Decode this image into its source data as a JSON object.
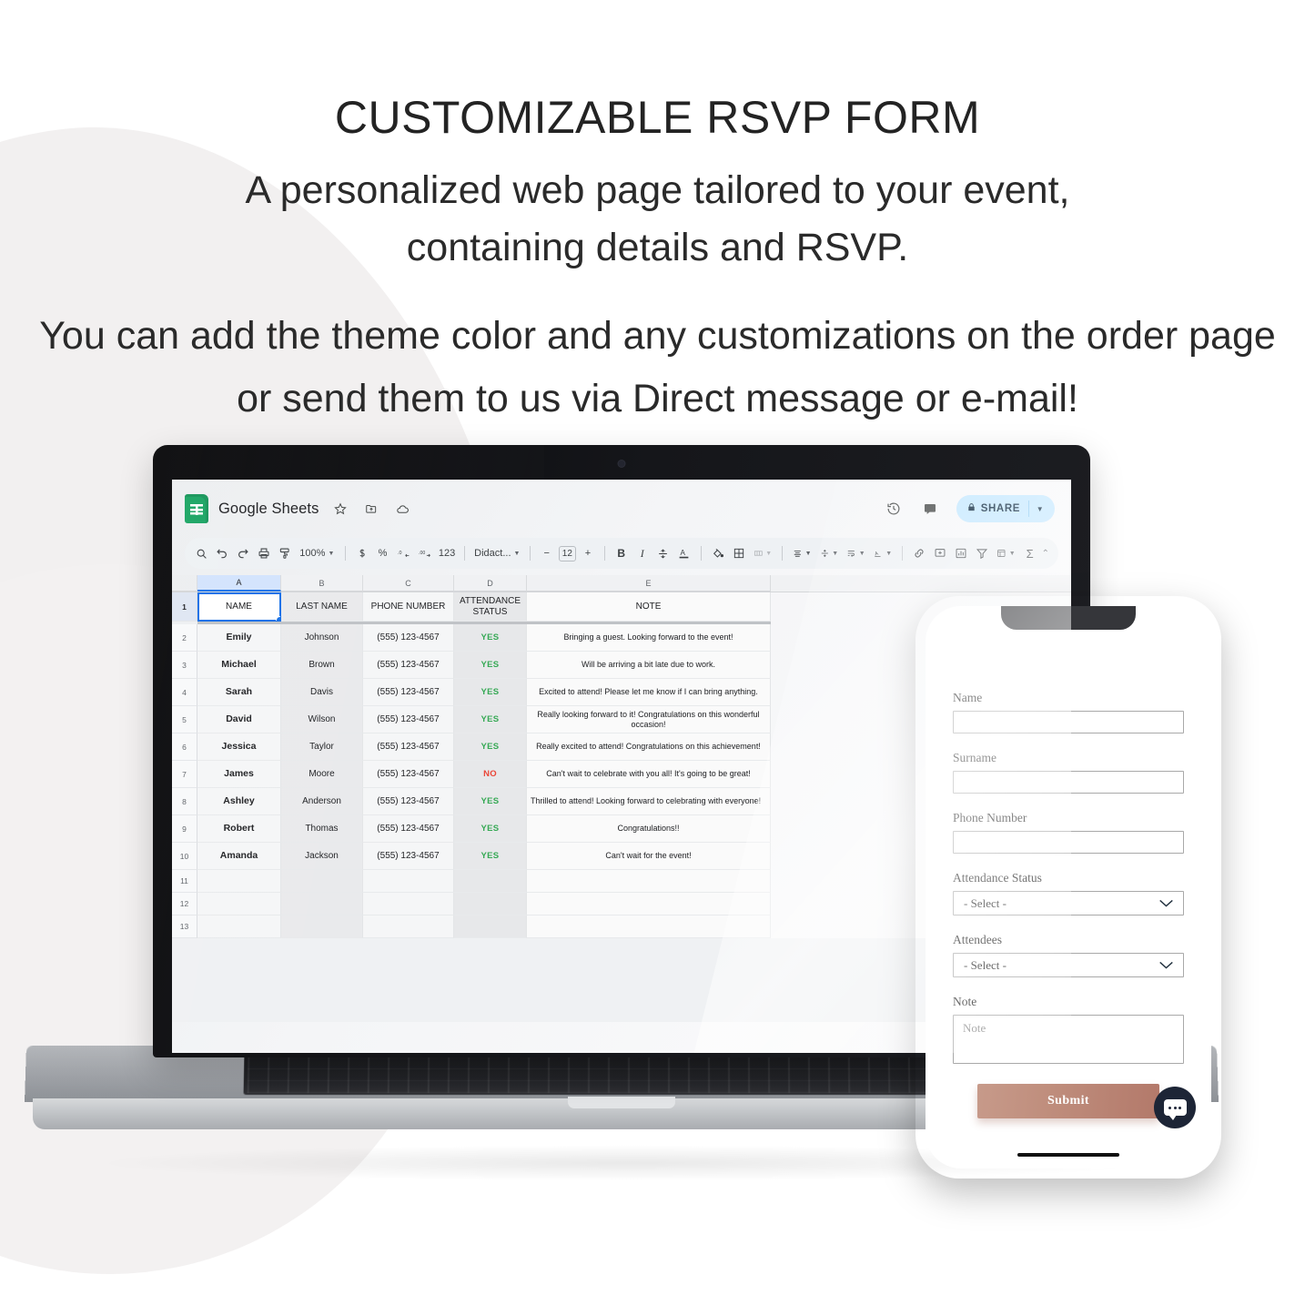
{
  "header": {
    "title": "CUSTOMIZABLE RSVP FORM",
    "subtitle_line1": "A personalized web page tailored to your event,",
    "subtitle_line2": "containing details and RSVP.",
    "body_line1": "You can add the theme color and any customizations on the order page",
    "body_line2": "or send them to us via Direct message or e-mail!"
  },
  "sheets": {
    "app_title": "Google Sheets",
    "head_icons": [
      "star-icon",
      "move-to-folder-icon",
      "cloud-saved-icon"
    ],
    "head_right_icons": [
      "version-history-icon",
      "comment-icon"
    ],
    "share_label": "SHARE",
    "toolbar": {
      "zoom": "100%",
      "font": "Didact...",
      "font_size": "12",
      "number_format": "123",
      "percent": "%",
      "decimal_decrease": ".0",
      "decimal_increase": ".00",
      "bold": "B",
      "italic": "I",
      "minus": "−",
      "plus": "+",
      "sigma": "Σ"
    },
    "column_letters": [
      "A",
      "B",
      "C",
      "D",
      "E"
    ],
    "headers": [
      "NAME",
      "LAST NAME",
      "PHONE NUMBER",
      "ATTENDANCE STATUS",
      "NOTE"
    ],
    "row_numbers": [
      "1",
      "2",
      "3",
      "4",
      "5",
      "6",
      "7",
      "8",
      "9",
      "10",
      "11",
      "12",
      "13"
    ],
    "rows": [
      {
        "n": "2",
        "name": "Emily",
        "last": "Johnson",
        "phone": "(555) 123-4567",
        "status": "YES",
        "note": "Bringing a guest. Looking forward to the event!"
      },
      {
        "n": "3",
        "name": "Michael",
        "last": "Brown",
        "phone": "(555) 123-4567",
        "status": "YES",
        "note": "Will be arriving a bit late due to work."
      },
      {
        "n": "4",
        "name": "Sarah",
        "last": "Davis",
        "phone": "(555) 123-4567",
        "status": "YES",
        "note": "Excited to attend! Please let me know if I can bring anything."
      },
      {
        "n": "5",
        "name": "David",
        "last": "Wilson",
        "phone": "(555) 123-4567",
        "status": "YES",
        "note": "Really looking forward to it! Congratulations on this wonderful occasion!"
      },
      {
        "n": "6",
        "name": "Jessica",
        "last": "Taylor",
        "phone": "(555) 123-4567",
        "status": "YES",
        "note": "Really excited to attend! Congratulations on this achievement!"
      },
      {
        "n": "7",
        "name": "James",
        "last": "Moore",
        "phone": "(555) 123-4567",
        "status": "NO",
        "note": "Can't wait to celebrate with you all! It's going to be great!"
      },
      {
        "n": "8",
        "name": "Ashley",
        "last": "Anderson",
        "phone": "(555) 123-4567",
        "status": "YES",
        "note": "Thrilled to attend! Looking forward to celebrating with everyone!"
      },
      {
        "n": "9",
        "name": "Robert",
        "last": "Thomas",
        "phone": "(555) 123-4567",
        "status": "YES",
        "note": "Congratulations!!"
      },
      {
        "n": "10",
        "name": "Amanda",
        "last": "Jackson",
        "phone": "(555) 123-4567",
        "status": "YES",
        "note": "Can't wait for the event!"
      }
    ],
    "empty_rows": [
      "11",
      "12",
      "13"
    ],
    "colors": {
      "yes": "#34a853",
      "no": "#ea4335",
      "brand": "#1aa463",
      "selection": "#1a73e8",
      "share_bg": "#c2e7ff"
    }
  },
  "phone_form": {
    "fields": [
      {
        "label": "Name",
        "type": "text",
        "value": "",
        "placeholder": ""
      },
      {
        "label": "Surname",
        "type": "text",
        "value": "",
        "placeholder": ""
      },
      {
        "label": "Phone Number",
        "type": "text",
        "value": "",
        "placeholder": ""
      },
      {
        "label": "Attendance Status",
        "type": "select",
        "value": "- Select -"
      },
      {
        "label": "Attendees",
        "type": "select",
        "value": "- Select -"
      },
      {
        "label": "Note",
        "type": "textarea",
        "value": "",
        "placeholder": "Note"
      }
    ],
    "submit_label": "Submit",
    "chat_icon": "chat-bubble-icon",
    "colors": {
      "submit_from": "#c79a8a",
      "submit_to": "#b3796a",
      "chat_bg": "#1d2536"
    }
  }
}
